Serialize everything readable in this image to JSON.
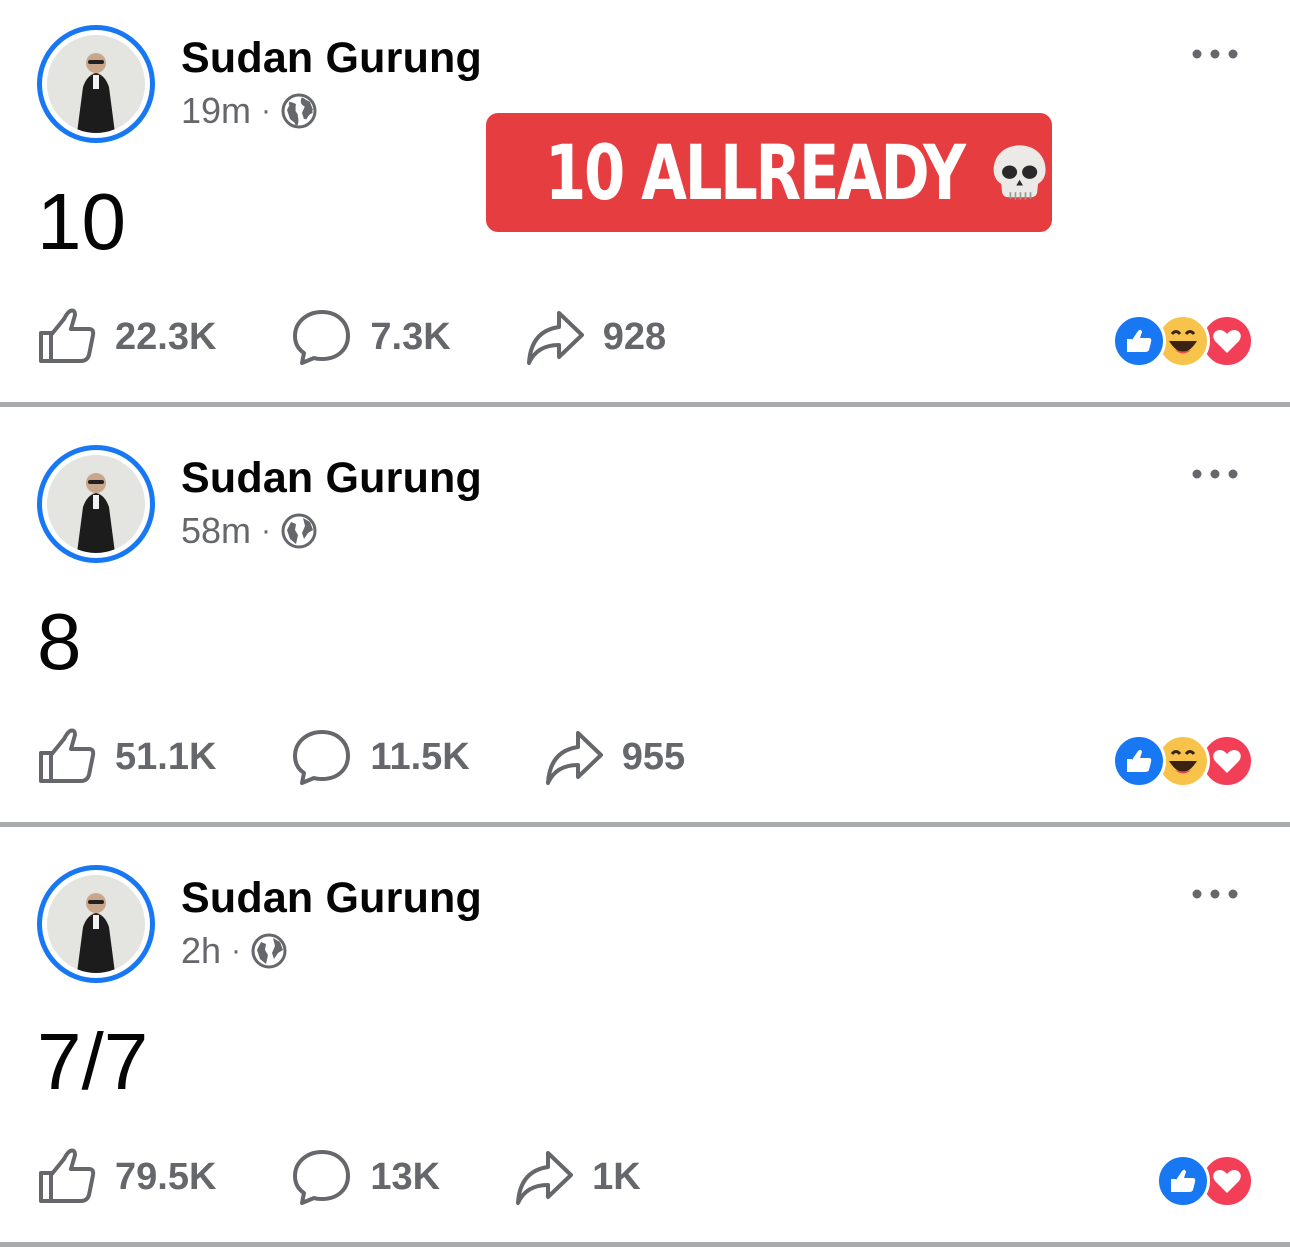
{
  "overlay_badge": {
    "text": "10 ALLREADY",
    "emoji_icon": "skull-emoji",
    "color": "#e63e40"
  },
  "accent_color": "#1877f2",
  "posts": [
    {
      "author": "Sudan Gurung",
      "time": "19m",
      "separator": "·",
      "privacy_icon": "globe-icon",
      "text": "10",
      "likes": "22.3K",
      "comments": "7.3K",
      "shares": "928",
      "reactions": [
        "like",
        "haha",
        "love"
      ]
    },
    {
      "author": "Sudan Gurung",
      "time": "58m",
      "separator": "·",
      "privacy_icon": "globe-icon",
      "text": "8",
      "likes": "51.1K",
      "comments": "11.5K",
      "shares": "955",
      "reactions": [
        "like",
        "haha",
        "love"
      ]
    },
    {
      "author": "Sudan Gurung",
      "time": "2h",
      "separator": "·",
      "privacy_icon": "globe-icon",
      "text": "7/7",
      "likes": "79.5K",
      "comments": "13K",
      "shares": "1K",
      "reactions": [
        "like",
        "love"
      ]
    }
  ]
}
